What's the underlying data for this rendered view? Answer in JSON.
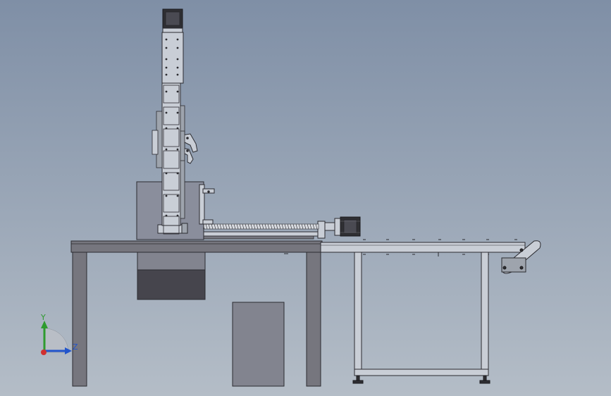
{
  "viewport": {
    "background_top": "#7f8fa6",
    "background_bottom": "#b4bdc7"
  },
  "colors": {
    "frame": "#76767e",
    "frame_edge": "#2b2b30",
    "panel_light": "#82848f",
    "panel_dark": "#46454d",
    "metal": "#c9ced6",
    "metal_dark": "#9ea4ad",
    "motor": "#2f2f33",
    "axis_y": "#2e9b2e",
    "axis_z": "#2255cc",
    "axis_x": "#d03030"
  },
  "triad": {
    "y_label": "Y",
    "z_label": "Z"
  }
}
